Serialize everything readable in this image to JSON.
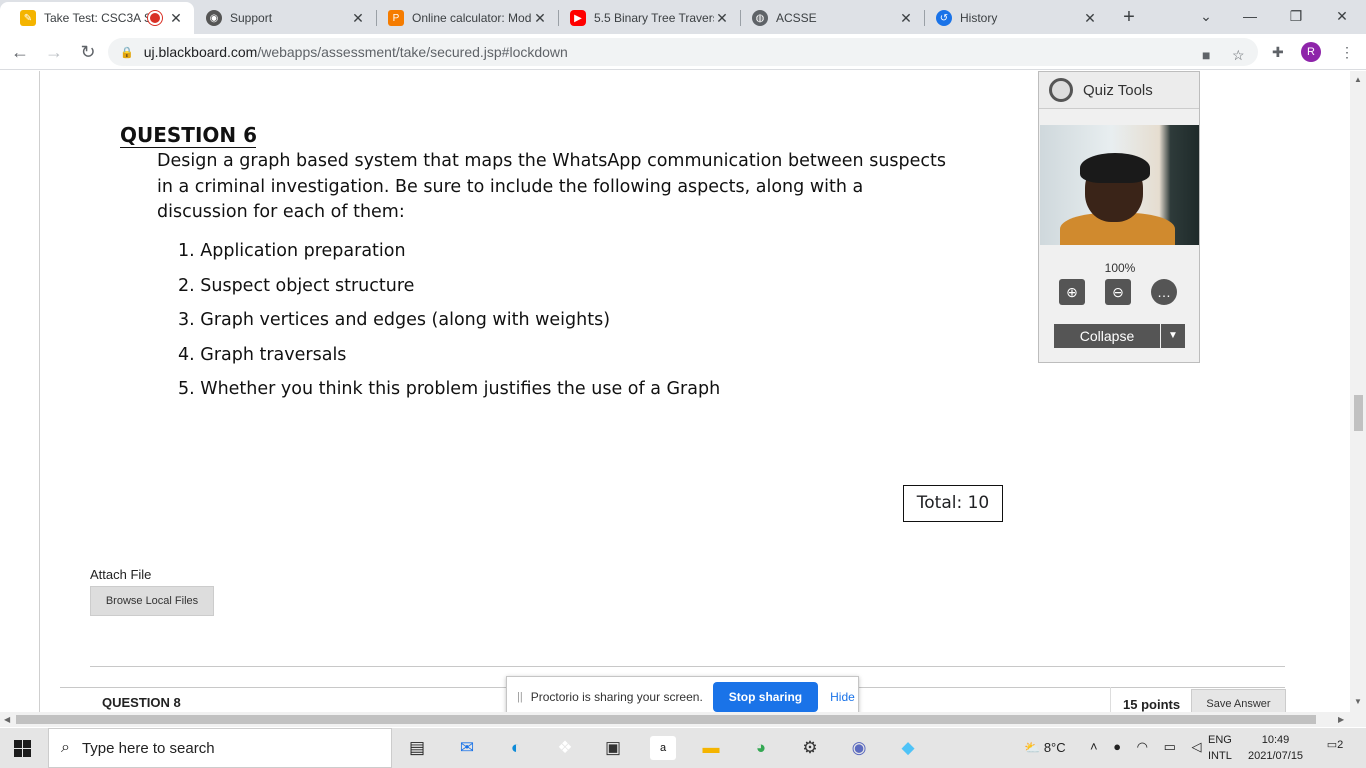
{
  "browser": {
    "tabs": [
      {
        "label": "Take Test: CSC3A S",
        "icon": "blackboard-icon",
        "color": "#f4b400",
        "active": true
      },
      {
        "label": "Support",
        "icon": "proctorio-icon",
        "color": "#555555"
      },
      {
        "label": "Online calculator: Mod",
        "icon": "calculator-icon",
        "color": "#f57c00"
      },
      {
        "label": "5.5 Binary Tree Travers",
        "icon": "youtube-icon",
        "color": "#ff0000"
      },
      {
        "label": "ACSSE",
        "icon": "globe-icon",
        "color": "#5f6368"
      },
      {
        "label": "History",
        "icon": "history-icon",
        "color": "#1a73e8"
      }
    ],
    "url_host": "uj.blackboard.com",
    "url_path": "/webapps/assessment/take/secured.jsp#lockdown",
    "profile_initial": "R"
  },
  "question6": {
    "title": "QUESTION 6",
    "body": "Design a graph based system that maps the WhatsApp communication between suspects in a criminal investigation.  Be sure to include the following aspects, along with a discussion for each of them:",
    "items": [
      "1.  Application preparation",
      "2.  Suspect object structure",
      "3.  Graph vertices and edges (along with weights)",
      "4.  Graph traversals",
      "5.  Whether you think this problem justifies the use of a Graph"
    ],
    "total": "Total:  10"
  },
  "attach": {
    "label": "Attach File",
    "button": "Browse Local Files"
  },
  "question8": {
    "title": "QUESTION 8",
    "points": "15 points",
    "save": "Save Answer"
  },
  "quiz_tools": {
    "title": "Quiz Tools",
    "zoom": "100%",
    "collapse": "Collapse"
  },
  "proctorio": {
    "text": "Proctorio is sharing your screen.",
    "stop": "Stop sharing",
    "hide": "Hide"
  },
  "taskbar": {
    "search_placeholder": "Type here to search",
    "weather": "8°C",
    "lang_line1": "ENG",
    "lang_line2": "INTL",
    "time": "10:49",
    "date": "2021/07/15",
    "notifications": "2"
  }
}
